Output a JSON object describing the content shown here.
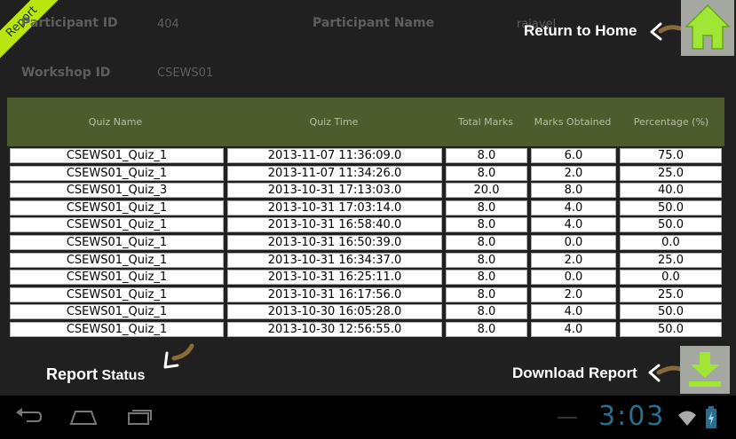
{
  "header": {
    "ribbon": "Report",
    "participant_id_label": "Participant ID",
    "participant_id_value": "404",
    "participant_name_label": "Participant Name",
    "participant_name_value": "rajavel",
    "workshop_id_label": "Workshop ID",
    "workshop_id_value": "CSEWS01"
  },
  "help": {
    "return_home": "Return to Home",
    "report_status_big": "Report",
    "report_status_small": "Status",
    "download_report": "Download Report"
  },
  "table": {
    "columns": [
      "Quiz Name",
      "Quiz Time",
      "Total Marks",
      "Marks Obtained",
      "Percentage (%)"
    ],
    "rows": [
      [
        "CSEWS01_Quiz_1",
        "2013-11-07 11:36:09.0",
        "8.0",
        "6.0",
        "75.0"
      ],
      [
        "CSEWS01_Quiz_1",
        "2013-11-07 11:34:26.0",
        "8.0",
        "2.0",
        "25.0"
      ],
      [
        "CSEWS01_Quiz_3",
        "2013-10-31 17:13:03.0",
        "20.0",
        "8.0",
        "40.0"
      ],
      [
        "CSEWS01_Quiz_1",
        "2013-10-31 17:03:14.0",
        "8.0",
        "4.0",
        "50.0"
      ],
      [
        "CSEWS01_Quiz_1",
        "2013-10-31 16:58:40.0",
        "8.0",
        "4.0",
        "50.0"
      ],
      [
        "CSEWS01_Quiz_1",
        "2013-10-31 16:50:39.0",
        "8.0",
        "0.0",
        "0.0"
      ],
      [
        "CSEWS01_Quiz_1",
        "2013-10-31 16:34:37.0",
        "8.0",
        "2.0",
        "25.0"
      ],
      [
        "CSEWS01_Quiz_1",
        "2013-10-31 16:25:11.0",
        "8.0",
        "0.0",
        "0.0"
      ],
      [
        "CSEWS01_Quiz_1",
        "2013-10-31 16:17:56.0",
        "8.0",
        "2.0",
        "25.0"
      ],
      [
        "CSEWS01_Quiz_1",
        "2013-10-30 16:05:28.0",
        "8.0",
        "4.0",
        "50.0"
      ],
      [
        "CSEWS01_Quiz_1",
        "2013-10-30 12:56:55.0",
        "8.0",
        "4.0",
        "50.0"
      ]
    ]
  },
  "status_bar": {
    "clock": "3:03"
  },
  "icons": {
    "home": "home-icon",
    "download": "download-icon",
    "back": "back-icon",
    "nav_home": "nav-home-icon",
    "recents": "recent-apps-icon",
    "wifi": "wifi-icon",
    "battery": "battery-icon"
  },
  "colors": {
    "ribbon": "#b9e60f",
    "table_header": "#4c5c2c",
    "button": "#a4a8a0",
    "clock": "#2a6e8e"
  }
}
